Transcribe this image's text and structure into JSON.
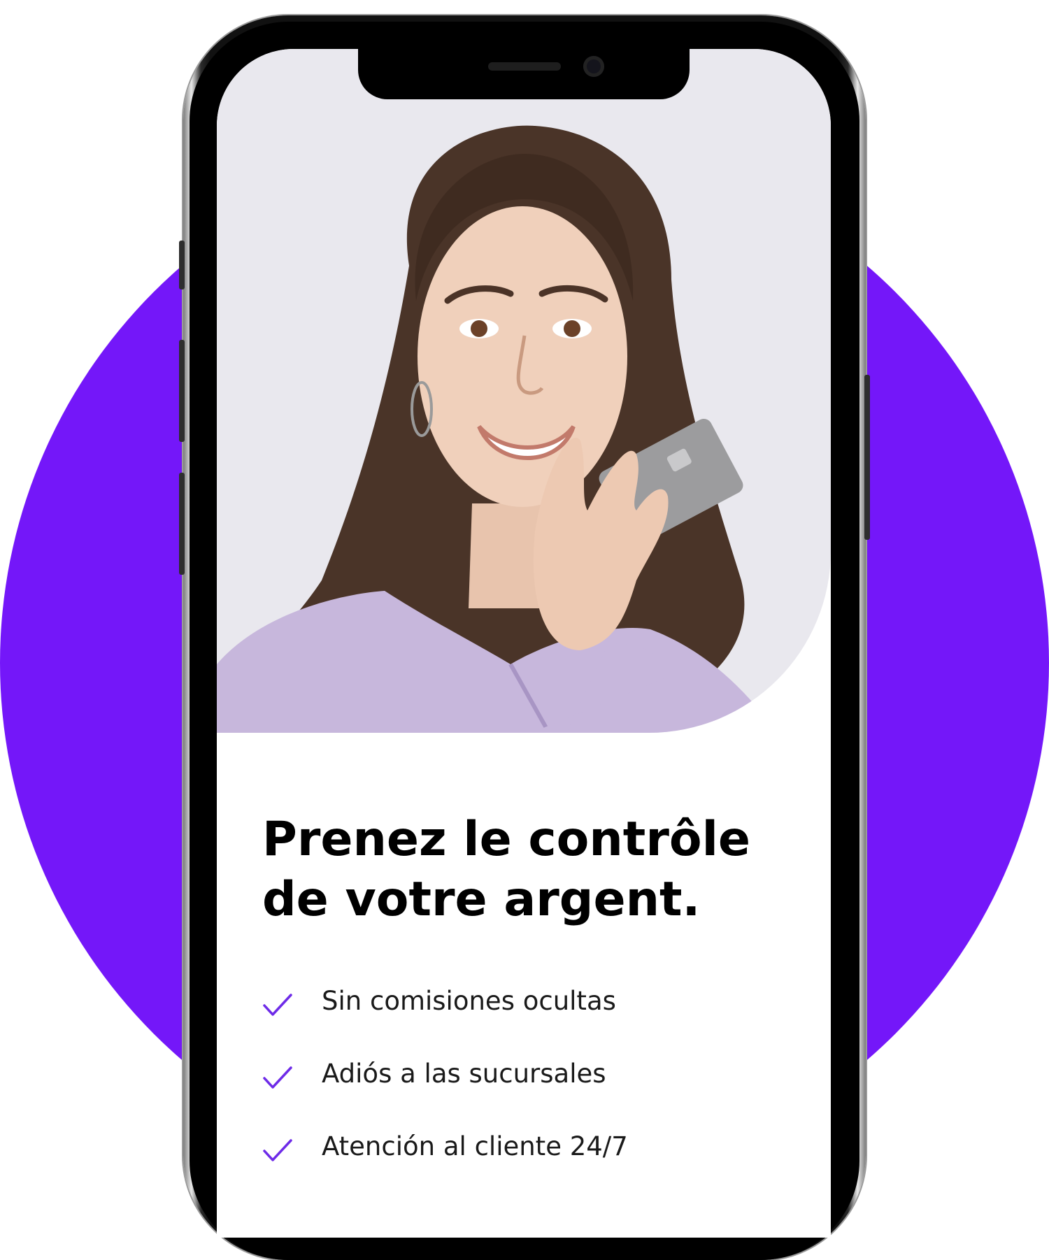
{
  "hero": {
    "headline_line1": "Prenez le contrôle",
    "headline_line2": "de votre argent.",
    "image_description_icon": "woman-holding-card-photo"
  },
  "features": [
    {
      "icon": "check-icon",
      "label": "Sin comisiones ocultas"
    },
    {
      "icon": "check-icon",
      "label": "Adiós a las sucursales"
    },
    {
      "icon": "check-icon",
      "label": "Atención al cliente 24/7"
    }
  ],
  "colors": {
    "accent": "#7417F9",
    "check": "#6E2BE8",
    "text": "#000000"
  }
}
